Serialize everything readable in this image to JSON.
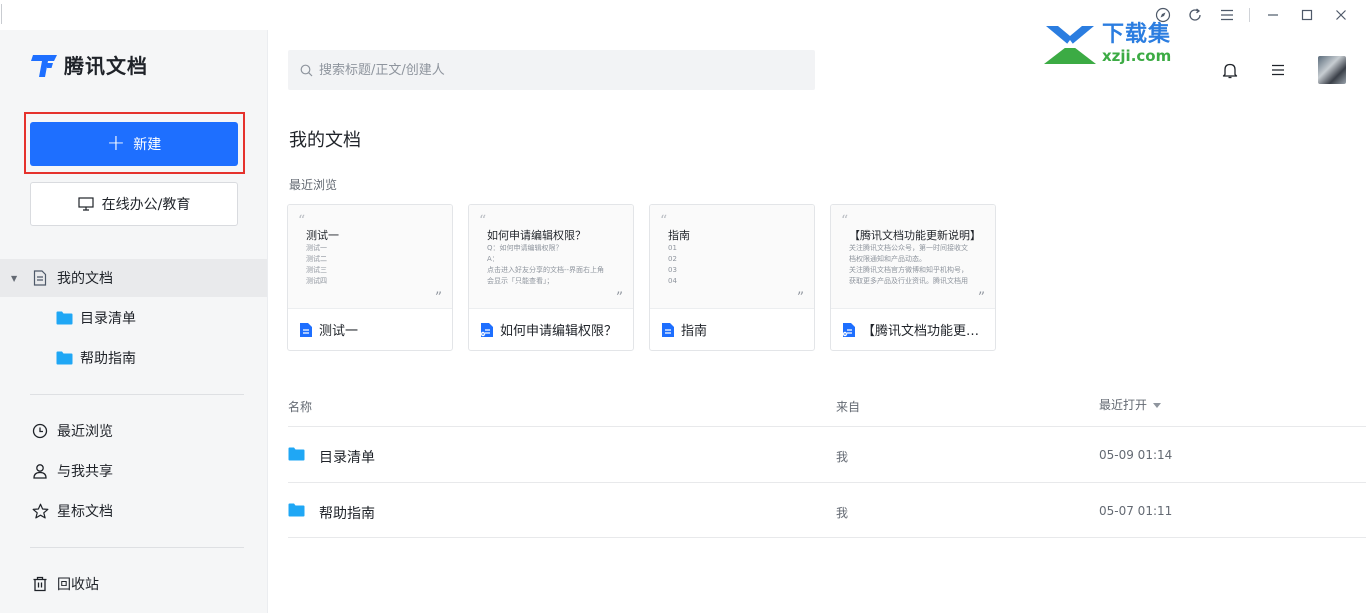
{
  "app": {
    "name": "腾讯文档",
    "watermark_cn": "下载集",
    "watermark_en": "xzji.com"
  },
  "sidebar": {
    "new_button": "新建",
    "office_button": "在线办公/教育",
    "tree": {
      "root_label": "我的文档",
      "children": [
        "目录清单",
        "帮助指南"
      ]
    },
    "nav": [
      {
        "label": "最近浏览",
        "icon": "clock-icon"
      },
      {
        "label": "与我共享",
        "icon": "person-icon"
      },
      {
        "label": "星标文档",
        "icon": "star-icon"
      }
    ],
    "trash": {
      "label": "回收站",
      "icon": "trash-icon"
    }
  },
  "search": {
    "placeholder": "搜索标题/正文/创建人"
  },
  "main": {
    "title": "我的文档",
    "recent_label": "最近浏览",
    "cards": [
      {
        "preview_title": "测试一",
        "preview_lines": [
          "测试一",
          "测试二",
          "测试三",
          "测试四"
        ],
        "name": "测试一",
        "icon": "doc-icon"
      },
      {
        "preview_title": "如何申请编辑权限？",
        "preview_lines": [
          "Q：如何申请编辑权限？",
          "A：",
          "点击进入好友分享的文档--界面右上角",
          "会显示「只能查看」；"
        ],
        "name": "如何申请编辑权限？",
        "icon": "shared-doc-icon"
      },
      {
        "preview_title": "指南",
        "preview_lines": [
          "01",
          "02",
          "03",
          "04"
        ],
        "name": "指南",
        "icon": "doc-icon"
      },
      {
        "preview_title": "【腾讯文档功能更新说明】",
        "preview_lines": [
          "关注腾讯文档公众号，第一时间接收文",
          "档权限通知和产品动态。",
          "关注腾讯文档官方微博和知乎机构号，",
          "获取更多产品及行业资讯。腾讯文档用"
        ],
        "name": "【腾讯文档功能更新说明】",
        "icon": "shared-doc-icon"
      }
    ],
    "list": {
      "columns": {
        "name": "名称",
        "from": "来自",
        "opened": "最近打开"
      },
      "rows": [
        {
          "name": "目录清单",
          "from": "我",
          "opened": "05-09 01:14"
        },
        {
          "name": "帮助指南",
          "from": "我",
          "opened": "05-07 01:11"
        }
      ]
    }
  },
  "colors": {
    "primary": "#1e6fff",
    "folder": "#1fa7f5",
    "highlight": "#e5322d"
  }
}
